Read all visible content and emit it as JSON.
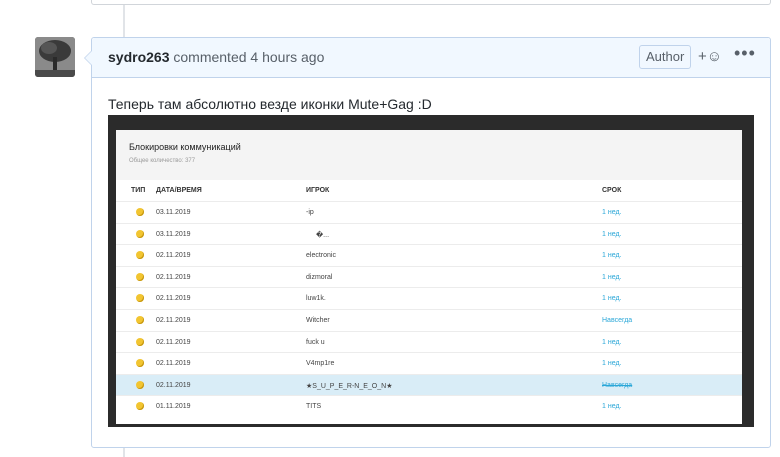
{
  "comment": {
    "username": "sydro263",
    "action_text": "commented 4 hours ago",
    "author_badge": "Author",
    "reaction_label": "+☺",
    "more_label": "•••",
    "body_text": "Теперь там абсолютно везде иконки Mute+Gag :D"
  },
  "panel": {
    "title": "Блокировки коммуникаций",
    "subtitle": "Общее количество: 377",
    "headers": {
      "type": "ТИП",
      "date": "ДАТА/ВРЕМЯ",
      "player": "ИГРОК",
      "term": "СРОК"
    },
    "rows": [
      {
        "date": "03.11.2019",
        "player": "-ip",
        "term": "1 нед."
      },
      {
        "date": "03.11.2019",
        "player": "�...",
        "term": "1 нед."
      },
      {
        "date": "02.11.2019",
        "player": "electronic",
        "term": "1 нед."
      },
      {
        "date": "02.11.2019",
        "player": "dizmoral",
        "term": "1 нед."
      },
      {
        "date": "02.11.2019",
        "player": "luw1k.",
        "term": "1 нед."
      },
      {
        "date": "02.11.2019",
        "player": "Witcher",
        "term": "Навсегда"
      },
      {
        "date": "02.11.2019",
        "player": "fuck u",
        "term": "1 нед."
      },
      {
        "date": "02.11.2019",
        "player": "V4mp1re",
        "term": "1 нед."
      },
      {
        "date": "02.11.2019",
        "player": "★S_U_P_E_R-N_E_O_N★",
        "term": "Навсегда"
      },
      {
        "date": "01.11.2019",
        "player": "TITS",
        "term": "1 нед."
      }
    ]
  }
}
